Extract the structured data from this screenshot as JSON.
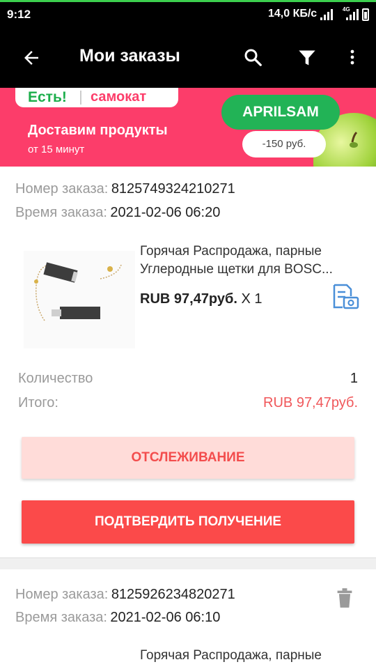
{
  "status_bar": {
    "time": "9:12",
    "speed": "14,0 КБ/с",
    "network": "4G"
  },
  "app_bar": {
    "title": "Мои заказы",
    "icons": [
      "back-arrow-icon",
      "search-icon",
      "filter-icon",
      "more-vert-icon"
    ]
  },
  "banner": {
    "brand_left": "Есть!",
    "brand_right": "самокат",
    "title": "Доставим продукты",
    "subtitle": "от 15 минут",
    "promo_code": "APRILSAM",
    "promo_discount": "-150 руб.",
    "colors": {
      "background": "#fc3d6a",
      "promo": "#22b356"
    }
  },
  "labels": {
    "order_number": "Номер заказа:",
    "order_time": "Время заказа:",
    "quantity": "Количество",
    "total": "Итого:"
  },
  "orders": [
    {
      "number": "8125749324210271",
      "time": "2021-02-06 06:20",
      "product": {
        "title_line1": "Горячая Распродажа, парные",
        "title_line2": "Углеродные щетки для BOSC...",
        "price": "RUB 97,47руб.",
        "qty_text": "X 1"
      },
      "quantity": "1",
      "total": "RUB 97,47руб.",
      "track_label": "ОТСЛЕЖИВАНИЕ",
      "confirm_label": "ПОДТВЕРДИТЬ ПОЛУЧЕНИЕ"
    },
    {
      "number": "8125926234820271",
      "time": "2021-02-06 06:10",
      "product": {
        "title_line1": "Горячая Распродажа, парные"
      }
    }
  ],
  "colors": {
    "accent": "#fb4a4a",
    "track_bg": "#ffdcd9",
    "total_text": "#f0575a"
  }
}
